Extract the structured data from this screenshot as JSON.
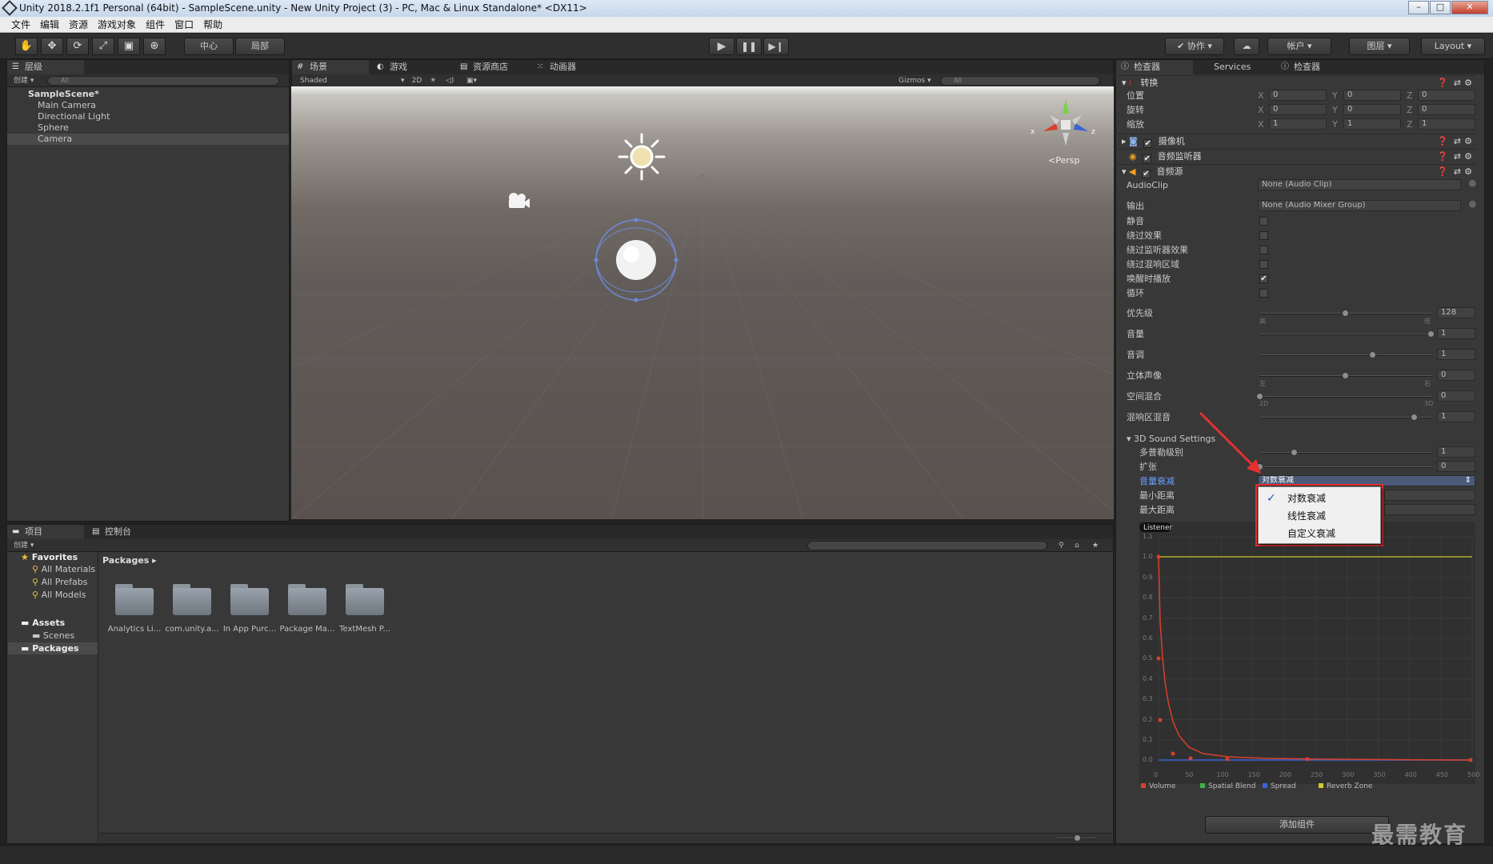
{
  "window": {
    "title": "Unity 2018.2.1f1 Personal (64bit) - SampleScene.unity - New Unity Project (3) - PC, Mac & Linux Standalone* <DX11>"
  },
  "menu": [
    "文件",
    "编辑",
    "资源",
    "游戏对象",
    "组件",
    "窗口",
    "帮助"
  ],
  "toolbar": {
    "pivot": "中心",
    "local": "局部",
    "collab": "协作",
    "account": "帐户",
    "layers": "图层",
    "layout": "Layout"
  },
  "hierarchy": {
    "tab": "层级",
    "create": "创建",
    "search": "All",
    "scene": "SampleScene*",
    "items": [
      "Main Camera",
      "Directional Light",
      "Sphere",
      "Camera"
    ]
  },
  "scene_view": {
    "tabs": [
      "场景",
      "游戏",
      "资源商店",
      "动画器"
    ],
    "shading": "Shaded",
    "mode2d": "2D",
    "gizmos": "Gizmos",
    "search": "All",
    "persp": "Persp",
    "axes": {
      "x": "x",
      "z": "z"
    }
  },
  "project": {
    "tabs": [
      "项目",
      "控制台"
    ],
    "create": "创建",
    "favorites_title": "Favorites",
    "favorites": [
      "All Materials",
      "All Prefabs",
      "All Models"
    ],
    "assets_title": "Assets",
    "assets_children": [
      "Scenes"
    ],
    "packages_title": "Packages",
    "breadcrumb": "Packages",
    "folders": [
      "Analytics Li...",
      "com.unity.a...",
      "In App Purc...",
      "Package Ma...",
      "TextMesh P..."
    ]
  },
  "inspector": {
    "tabs": [
      "检查器",
      "Services",
      "检查器"
    ],
    "transform": {
      "title": "转换",
      "rows": [
        {
          "label": "位置",
          "x": "0",
          "y": "0",
          "z": "0"
        },
        {
          "label": "旋转",
          "x": "0",
          "y": "0",
          "z": "0"
        },
        {
          "label": "缩放",
          "x": "1",
          "y": "1",
          "z": "1"
        }
      ],
      "axis_labels": [
        "X",
        "Y",
        "Z"
      ]
    },
    "components": [
      "摄像机",
      "音频监听器",
      "音频源"
    ],
    "audio": {
      "clip_label": "AudioClip",
      "clip_value": "None (Audio Clip)",
      "output_label": "输出",
      "output_value": "None (Audio Mixer Group)",
      "toggles": [
        {
          "label": "静音",
          "checked": false
        },
        {
          "label": "绕过效果",
          "checked": false
        },
        {
          "label": "绕过监听器效果",
          "checked": false
        },
        {
          "label": "绕过混响区域",
          "checked": false
        },
        {
          "label": "唤醒时播放",
          "checked": true
        },
        {
          "label": "循环",
          "checked": false
        }
      ],
      "sliders": [
        {
          "label": "优先级",
          "value": "128",
          "pos": 0.5,
          "left": "高",
          "right": "低"
        },
        {
          "label": "音量",
          "value": "1",
          "pos": 1.0
        },
        {
          "label": "音调",
          "value": "1",
          "pos": 0.66
        },
        {
          "label": "立体声像",
          "value": "0",
          "pos": 0.5,
          "left": "左",
          "right": "右"
        },
        {
          "label": "空间混合",
          "value": "0",
          "pos": 0.0,
          "left": "2D",
          "right": "3D"
        },
        {
          "label": "混响区混音",
          "value": "1",
          "pos": 0.9
        }
      ],
      "sound3d_title": "3D Sound Settings",
      "sound3d": [
        {
          "label": "多普勒级别",
          "value": "1",
          "pos": 0.2
        },
        {
          "label": "扩张",
          "value": "0",
          "pos": 0.0
        }
      ],
      "rolloff_label": "音量衰减",
      "rolloff_value": "对数衰减",
      "min_label": "最小距离",
      "max_label": "最大距离",
      "rolloff_options": [
        {
          "label": "对数衰减",
          "checked": true
        },
        {
          "label": "线性衰减",
          "checked": false
        },
        {
          "label": "自定义衰减",
          "checked": false
        }
      ],
      "graph": {
        "listener": "Listener",
        "y_ticks": [
          "1.1",
          "1.0",
          "0.9",
          "0.8",
          "0.7",
          "0.6",
          "0.5",
          "0.4",
          "0.3",
          "0.2",
          "0.1",
          "0.0"
        ],
        "x_ticks": [
          "0",
          "50",
          "100",
          "150",
          "200",
          "250",
          "300",
          "350",
          "400",
          "450",
          "500"
        ],
        "legend": [
          {
            "label": "Volume",
            "color": "#d9402c"
          },
          {
            "label": "Spatial Blend",
            "color": "#3fb24a"
          },
          {
            "label": "Spread",
            "color": "#3a63d6"
          },
          {
            "label": "Reverb Zone",
            "color": "#d4c92e"
          }
        ]
      },
      "add_component": "添加组件"
    }
  },
  "watermark": "最需教育"
}
